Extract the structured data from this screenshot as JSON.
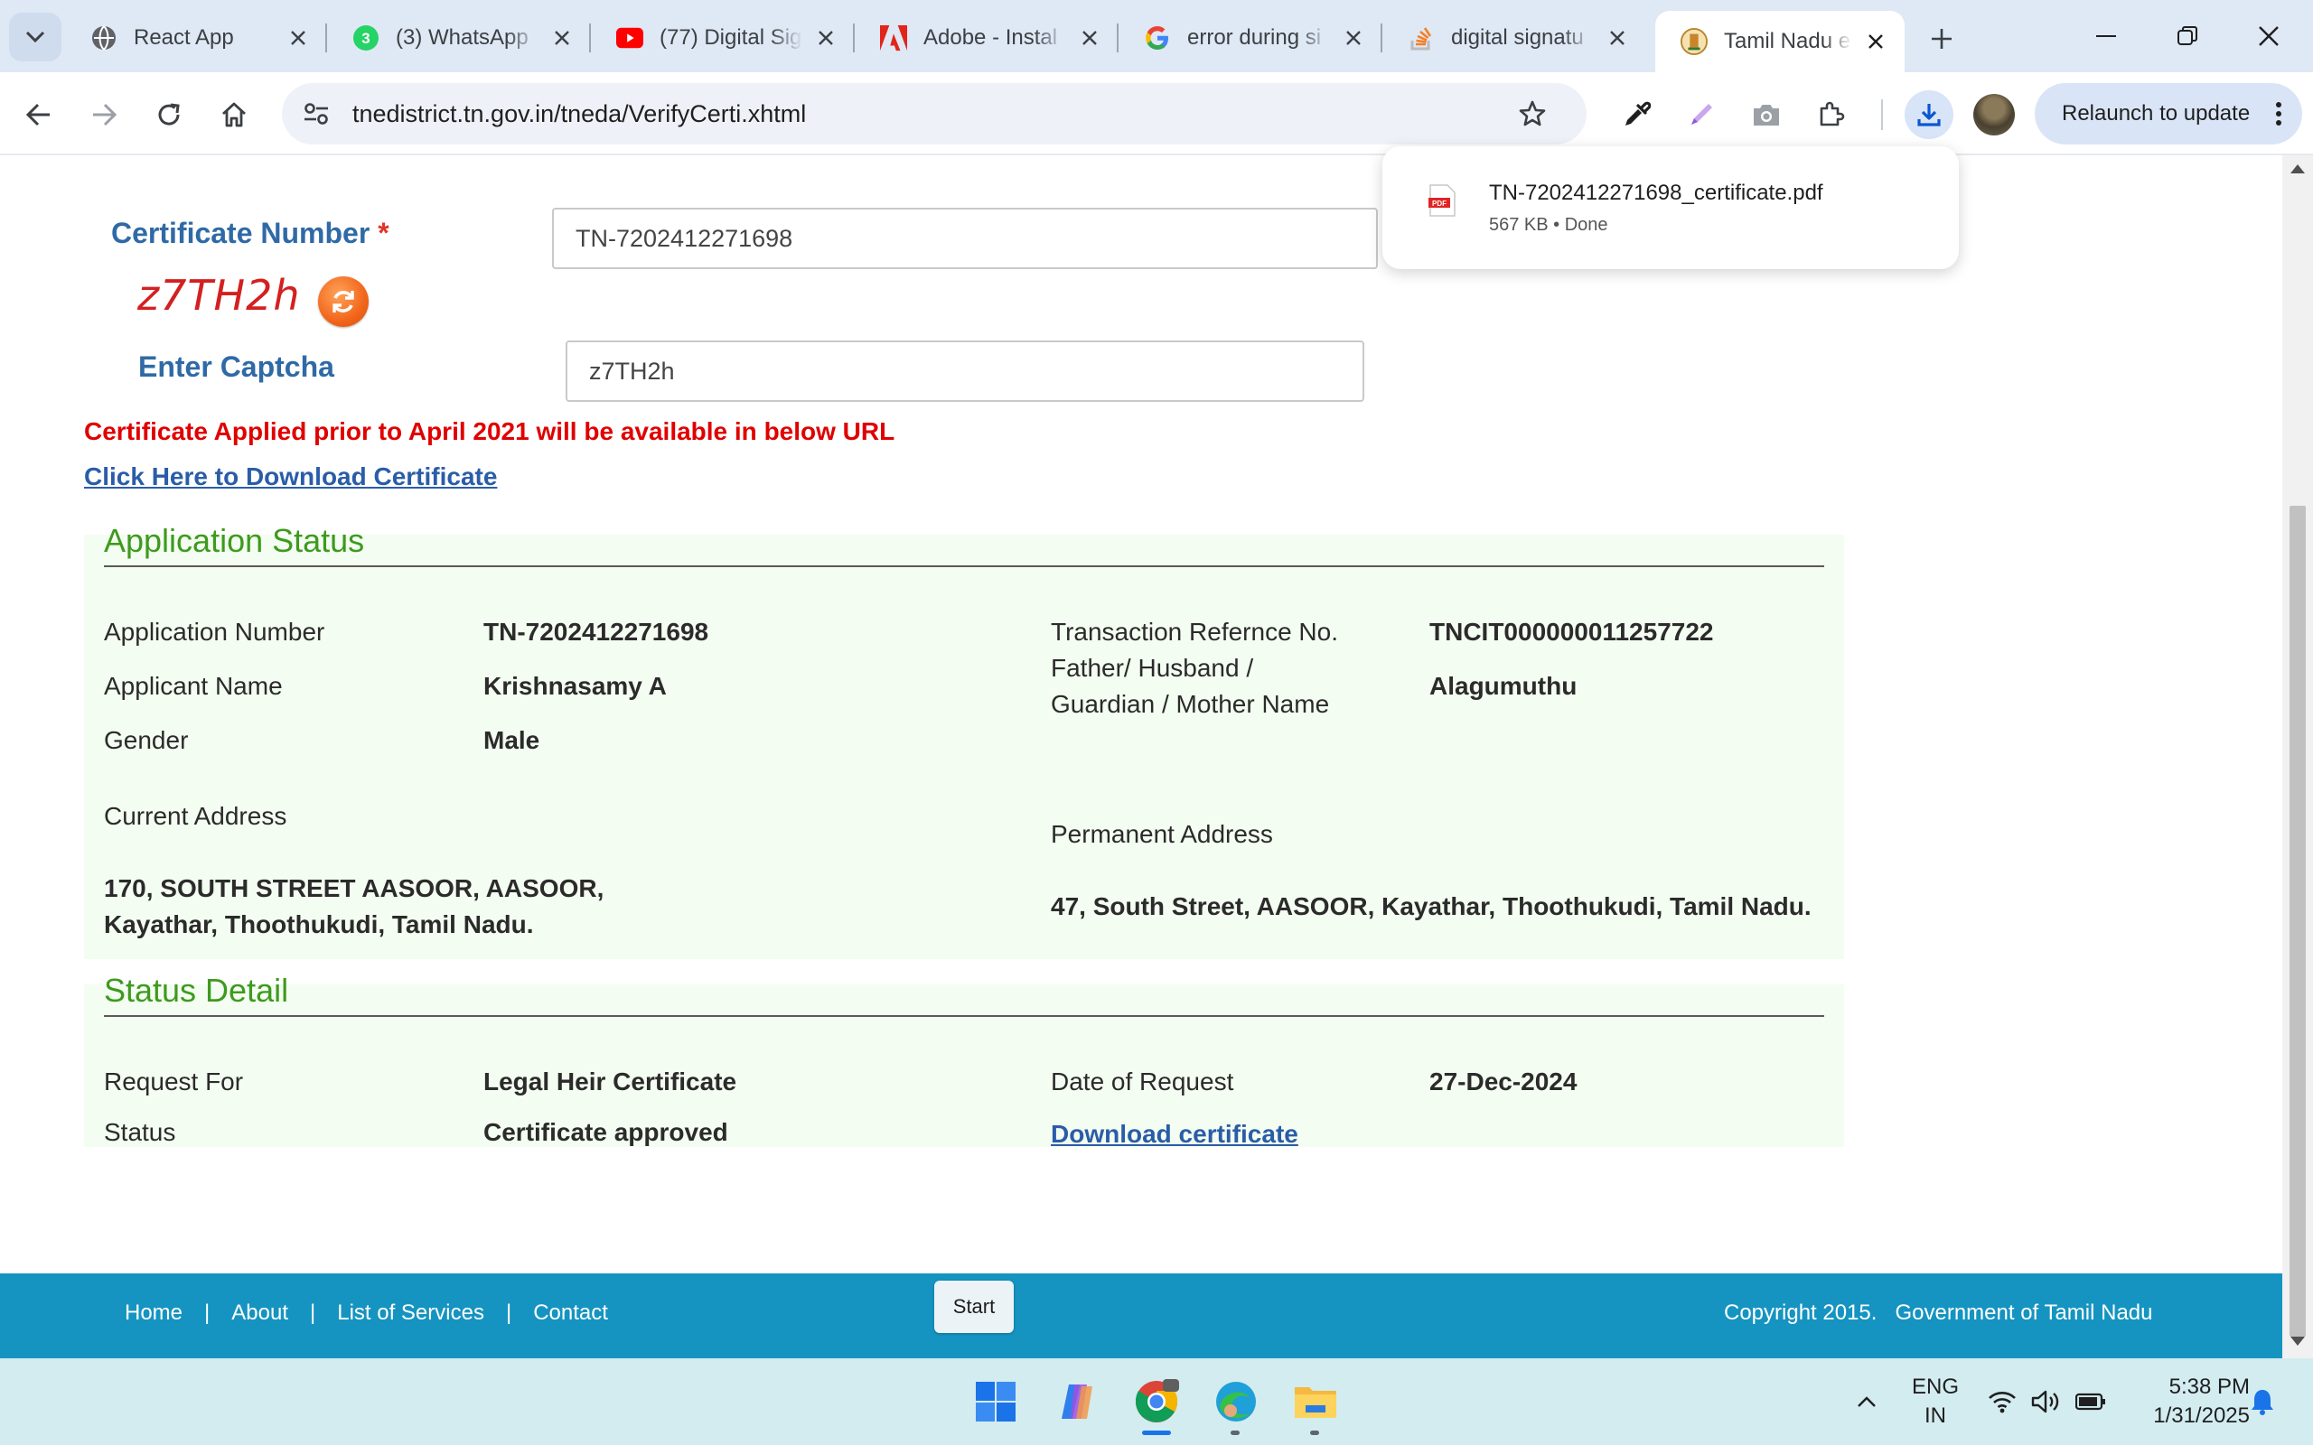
{
  "browser": {
    "tabs": [
      {
        "title": "React App",
        "icon": "globe-icon"
      },
      {
        "title": "(3) WhatsApp",
        "icon": "whatsapp-icon",
        "badge": "3"
      },
      {
        "title": "(77) Digital Sig",
        "icon": "youtube-icon"
      },
      {
        "title": "Adobe - Instal",
        "icon": "adobe-icon"
      },
      {
        "title": "error during si",
        "icon": "google-icon"
      },
      {
        "title": "digital signatu",
        "icon": "stackoverflow-icon"
      },
      {
        "title": "Tamil Nadu e-",
        "icon": "tn-emblem-icon",
        "active": true
      }
    ],
    "url": "tnedistrict.tn.gov.in/tneda/VerifyCerti.xhtml",
    "relaunch_label": "Relaunch to update",
    "download": {
      "filename": "TN-7202412271698_certificate.pdf",
      "meta": "567 KB • Done",
      "file_type": "PDF"
    }
  },
  "form": {
    "certificate_label": "Certificate Number",
    "required_mark": "*",
    "certificate_value": "TN-7202412271698",
    "captcha_image_text": "z7TH2h",
    "captcha_label": "Enter Captcha",
    "captcha_value": "z7TH2h",
    "notice": "Certificate Applied prior to April 2021 will be available in below URL",
    "download_link": "Click Here to Download Certificate"
  },
  "application_status": {
    "title": "Application Status",
    "application_number_label": "Application Number",
    "application_number": "TN-7202412271698",
    "transaction_label": "Transaction Refernce No.",
    "transaction_value": "TNCIT000000011257722",
    "applicant_name_label": "Applicant Name",
    "applicant_name": "Krishnasamy A",
    "guardian_label_1": "Father/ Husband /",
    "guardian_label_2": "Guardian / Mother Name",
    "guardian_value": "Alagumuthu",
    "gender_label": "Gender",
    "gender": "Male",
    "current_address_label": "Current Address",
    "current_address_1": "170, SOUTH STREET AASOOR, AASOOR,",
    "current_address_2": "Kayathar, Thoothukudi, Tamil Nadu.",
    "permanent_address_label": "Permanent Address",
    "permanent_address": "47, South Street, AASOOR, Kayathar, Thoothukudi, Tamil Nadu."
  },
  "status_detail": {
    "title": "Status Detail",
    "request_for_label": "Request For",
    "request_for": "Legal Heir Certificate",
    "date_label": "Date of Request",
    "date_value": "27-Dec-2024",
    "status_label": "Status",
    "status_value": "Certificate approved",
    "download_label": "Download certificate"
  },
  "footer": {
    "links": [
      "Home",
      "About",
      "List of Services",
      "Contact"
    ],
    "separator": "|",
    "copyright": "Copyright 2015.",
    "org": "Government of Tamil Nadu",
    "start_label": "Start"
  },
  "taskbar": {
    "apps": [
      "windows-start-icon",
      "copilot-icon",
      "chrome-icon",
      "edge-icon",
      "file-explorer-icon"
    ],
    "lang_1": "ENG",
    "lang_2": "IN",
    "time": "5:38 PM",
    "date": "1/31/2025"
  },
  "colors": {
    "accent_blue": "#2f6aa6",
    "error_red": "#e00000",
    "section_green": "#3e9a1e",
    "footer_teal": "#1594c1",
    "panel_bg": "#f4fdf1"
  }
}
